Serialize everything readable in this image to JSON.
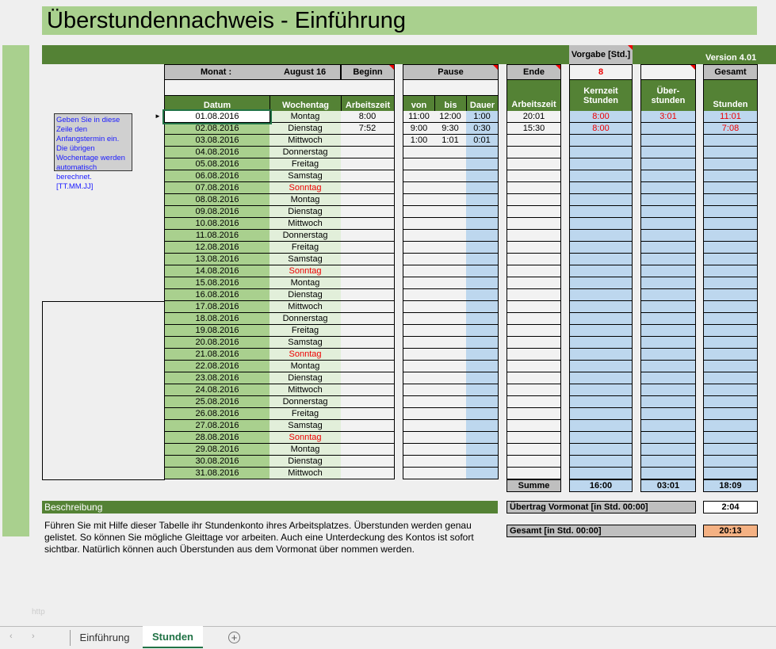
{
  "title": "Überstundennachweis - Einführung",
  "version": "Version 4.01",
  "vorgabe": {
    "label": "Vorgabe [Std.]",
    "value": "8"
  },
  "monat": {
    "label": "Monat :",
    "value": "August 16"
  },
  "groups": {
    "beginn": "Beginn",
    "pause": "Pause",
    "ende": "Ende",
    "gesamt": "Gesamt"
  },
  "columns": {
    "datum": "Datum",
    "wochentag": "Wochentag",
    "arbeitszeit": "Arbeitszeit",
    "von": "von",
    "bis": "bis",
    "dauer": "Dauer",
    "ende_arbeitszeit": "Arbeitszeit",
    "kernzeit1": "Kernzeit",
    "kernzeit2": "Stunden",
    "ueber1": "Über-",
    "ueber2": "stunden",
    "gesamt": "Stunden"
  },
  "note": "Geben Sie in diese Zeile den Anfangstermin ein.  Die übrigen Wochentage werden automatisch berechnet. [TT.MM.JJ]",
  "rows": [
    {
      "d": "01.08.2016",
      "w": "Montag",
      "a": "8:00",
      "von": "11:00",
      "bis": "12:00",
      "dau": "1:00",
      "e": "20:01",
      "k": "8:00",
      "u": "3:01",
      "g": "11:01"
    },
    {
      "d": "02.08.2016",
      "w": "Dienstag",
      "a": "7:52",
      "von": "9:00",
      "bis": "9:30",
      "dau": "0:30",
      "e": "15:30",
      "k": "8:00",
      "u": "",
      "g": "7:08"
    },
    {
      "d": "03.08.2016",
      "w": "Mittwoch",
      "a": "",
      "von": "1:00",
      "bis": "1:01",
      "dau": "0:01",
      "e": "",
      "k": "",
      "u": "",
      "g": ""
    },
    {
      "d": "04.08.2016",
      "w": "Donnerstag"
    },
    {
      "d": "05.08.2016",
      "w": "Freitag"
    },
    {
      "d": "06.08.2016",
      "w": "Samstag"
    },
    {
      "d": "07.08.2016",
      "w": "Sonntag"
    },
    {
      "d": "08.08.2016",
      "w": "Montag"
    },
    {
      "d": "09.08.2016",
      "w": "Dienstag"
    },
    {
      "d": "10.08.2016",
      "w": "Mittwoch"
    },
    {
      "d": "11.08.2016",
      "w": "Donnerstag"
    },
    {
      "d": "12.08.2016",
      "w": "Freitag"
    },
    {
      "d": "13.08.2016",
      "w": "Samstag"
    },
    {
      "d": "14.08.2016",
      "w": "Sonntag"
    },
    {
      "d": "15.08.2016",
      "w": "Montag"
    },
    {
      "d": "16.08.2016",
      "w": "Dienstag"
    },
    {
      "d": "17.08.2016",
      "w": "Mittwoch"
    },
    {
      "d": "18.08.2016",
      "w": "Donnerstag"
    },
    {
      "d": "19.08.2016",
      "w": "Freitag"
    },
    {
      "d": "20.08.2016",
      "w": "Samstag"
    },
    {
      "d": "21.08.2016",
      "w": "Sonntag"
    },
    {
      "d": "22.08.2016",
      "w": "Montag"
    },
    {
      "d": "23.08.2016",
      "w": "Dienstag"
    },
    {
      "d": "24.08.2016",
      "w": "Mittwoch"
    },
    {
      "d": "25.08.2016",
      "w": "Donnerstag"
    },
    {
      "d": "26.08.2016",
      "w": "Freitag"
    },
    {
      "d": "27.08.2016",
      "w": "Samstag"
    },
    {
      "d": "28.08.2016",
      "w": "Sonntag"
    },
    {
      "d": "29.08.2016",
      "w": "Montag"
    },
    {
      "d": "30.08.2016",
      "w": "Dienstag"
    },
    {
      "d": "31.08.2016",
      "w": "Mittwoch"
    }
  ],
  "summe": {
    "label": "Summe",
    "kernzeit": "16:00",
    "ueber": "03:01",
    "gesamt": "18:09"
  },
  "beschreibung": {
    "title": "Beschreibung",
    "text": "Führen Sie mit Hilfe dieser Tabelle ihr Stundenkonto ihres Arbeitsplatzes. Überstunden werden genau gelistet. So können Sie mögliche Gleittage vor arbeiten. Auch eine Unterdeckung des Kontos ist  sofort sichtbar. Natürlich können auch Überstunden aus dem Vormonat über nommen werden."
  },
  "uebertrag": {
    "label": "Übertrag Vormonat [in Std. 00:00]",
    "value": "2:04"
  },
  "gesamt_total": {
    "label": "Gesamt [in Std. 00:00]",
    "value": "20:13"
  },
  "watermark": "http",
  "tabs": [
    {
      "label": "Einführung"
    },
    {
      "label": "Stunden"
    }
  ],
  "colors": {
    "dark_green": "#548235",
    "light_green": "#a9d08e",
    "blue": "#bdd7ee",
    "orange": "#f4b183",
    "red": "#e00000"
  }
}
